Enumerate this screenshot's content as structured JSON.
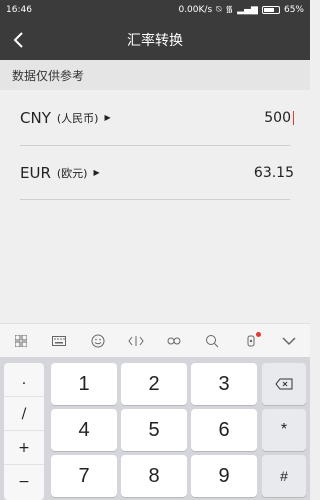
{
  "status_bar": {
    "time": "16:46",
    "network_speed": "0.00K/s",
    "battery_percent": "65%"
  },
  "app_bar": {
    "title": "汇率转换"
  },
  "info_strip": {
    "text": "数据仅供参考"
  },
  "rows": [
    {
      "code": "CNY",
      "name": "(人民币)",
      "value": "500"
    },
    {
      "code": "EUR",
      "name": "(欧元)",
      "value": "63.15"
    }
  ],
  "keyboard": {
    "symbols": [
      ".",
      "/",
      "+",
      "−"
    ],
    "keys": [
      "1",
      "2",
      "3",
      "4",
      "5",
      "6",
      "7",
      "8",
      "9"
    ],
    "star": "*",
    "hash": "#"
  }
}
